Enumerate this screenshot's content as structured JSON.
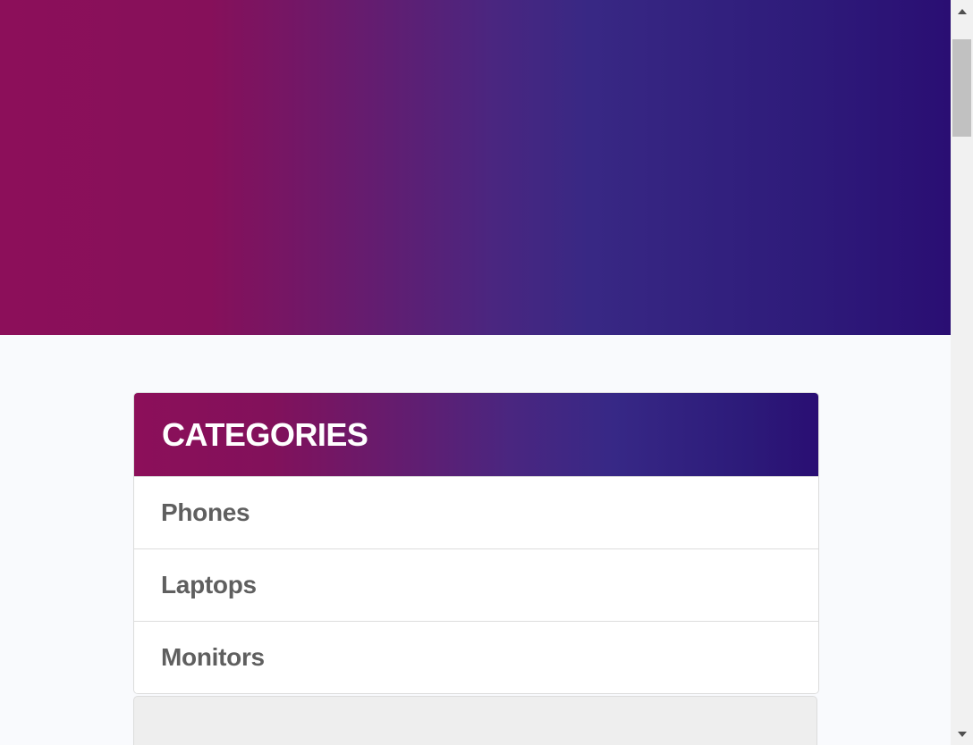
{
  "categories": {
    "title": "CATEGORIES",
    "items": [
      {
        "label": "Phones"
      },
      {
        "label": "Laptops"
      },
      {
        "label": "Monitors"
      }
    ]
  },
  "colors": {
    "gradient_start": "#8c0f5a",
    "gradient_end": "#2a0e73",
    "page_background": "#f9fafd",
    "item_text": "#5f5f5f"
  },
  "scrollbar": {
    "up_icon": "triangle-up-icon",
    "down_icon": "triangle-down-icon"
  }
}
